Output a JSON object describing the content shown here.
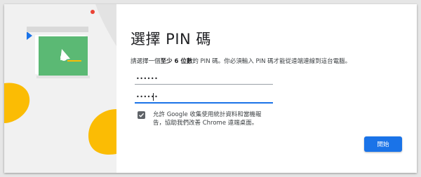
{
  "dialog": {
    "title": "選擇 PIN 碼",
    "description": {
      "before": "請選擇一個",
      "bold": "至少 6 位數",
      "after": "的 PIN 碼。你必須輸入 PIN 碼才能從遠端連線到這台電腦。"
    },
    "pin_field": {
      "value": "••••••",
      "type": "password"
    },
    "confirm_pin_field": {
      "value": "••••••",
      "type": "password"
    },
    "consent": {
      "checked": true,
      "line1": "允許 Google 收集使用統計資料和當機報",
      "line2": "告，協助我們改善 Chrome 遠端桌面。"
    },
    "start_button": "開始"
  },
  "illustration": {
    "screen_color": "#5bb974",
    "blue_accent": "#1a73e8",
    "yellow_accent": "#fbbc04",
    "red_dot": "#ea4335",
    "icon": "remote-desktop-illustration"
  },
  "colors": {
    "primary": "#1a73e8",
    "text": "#202124",
    "secondary_text": "#3c4043"
  }
}
